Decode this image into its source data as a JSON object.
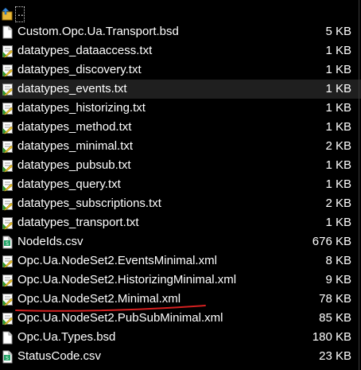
{
  "parent_entry": {
    "label": ".."
  },
  "files": [
    {
      "name": "Custom.Opc.Ua.Transport.bsd",
      "size": "5 KB",
      "icon": "blank-file-icon"
    },
    {
      "name": "datatypes_dataaccess.txt",
      "size": "1 KB",
      "icon": "text-file-icon"
    },
    {
      "name": "datatypes_discovery.txt",
      "size": "1 KB",
      "icon": "text-file-icon"
    },
    {
      "name": "datatypes_events.txt",
      "size": "1 KB",
      "icon": "text-file-icon"
    },
    {
      "name": "datatypes_historizing.txt",
      "size": "1 KB",
      "icon": "text-file-icon"
    },
    {
      "name": "datatypes_method.txt",
      "size": "1 KB",
      "icon": "text-file-icon"
    },
    {
      "name": "datatypes_minimal.txt",
      "size": "2 KB",
      "icon": "text-file-icon"
    },
    {
      "name": "datatypes_pubsub.txt",
      "size": "1 KB",
      "icon": "text-file-icon"
    },
    {
      "name": "datatypes_query.txt",
      "size": "1 KB",
      "icon": "text-file-icon"
    },
    {
      "name": "datatypes_subscriptions.txt",
      "size": "2 KB",
      "icon": "text-file-icon"
    },
    {
      "name": "datatypes_transport.txt",
      "size": "1 KB",
      "icon": "text-file-icon"
    },
    {
      "name": "NodeIds.csv",
      "size": "676 KB",
      "icon": "csv-file-icon"
    },
    {
      "name": "Opc.Ua.NodeSet2.EventsMinimal.xml",
      "size": "8 KB",
      "icon": "xml-file-icon"
    },
    {
      "name": "Opc.Ua.NodeSet2.HistorizingMinimal.xml",
      "size": "9 KB",
      "icon": "xml-file-icon"
    },
    {
      "name": "Opc.Ua.NodeSet2.Minimal.xml",
      "size": "78 KB",
      "icon": "xml-file-icon"
    },
    {
      "name": "Opc.Ua.NodeSet2.PubSubMinimal.xml",
      "size": "85 KB",
      "icon": "xml-file-icon"
    },
    {
      "name": "Opc.Ua.Types.bsd",
      "size": "180 KB",
      "icon": "blank-file-icon"
    },
    {
      "name": "StatusCode.csv",
      "size": "23 KB",
      "icon": "csv-file-icon"
    }
  ],
  "selected_index": 3,
  "colors": {
    "background": "#000000",
    "text": "#ffffff",
    "selection": "#1f1f1f",
    "annotation_underline": "#d42020"
  }
}
